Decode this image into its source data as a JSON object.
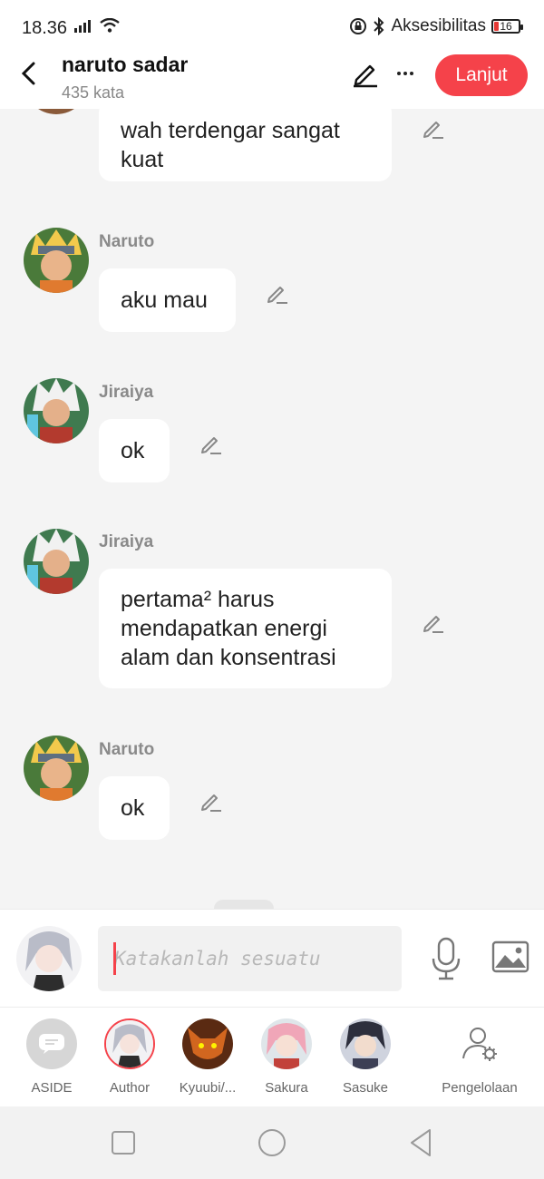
{
  "status_bar": {
    "time": "18.36",
    "accessibility_label": "Aksesibilitas",
    "battery": "16"
  },
  "header": {
    "title": "naruto sadar",
    "subtitle": "435 kata",
    "next_button": "Lanjut"
  },
  "messages": [
    {
      "speaker": "",
      "text_lines": [
        "wah terdengar sangat",
        "kuat"
      ]
    },
    {
      "speaker": "Naruto",
      "text_lines": [
        "aku mau"
      ]
    },
    {
      "speaker": "Jiraiya",
      "text_lines": [
        "ok"
      ]
    },
    {
      "speaker": "Jiraiya",
      "text_lines": [
        "pertama² harus",
        "mendapatkan energi",
        "alam dan konsentrasi"
      ]
    },
    {
      "speaker": "Naruto",
      "text_lines": [
        "ok"
      ]
    }
  ],
  "input": {
    "placeholder": "Katakanlah sesuatu",
    "value": ""
  },
  "characters": [
    {
      "label": "ASIDE",
      "selected": false
    },
    {
      "label": "Author",
      "selected": true
    },
    {
      "label": "Kyuubi/...",
      "selected": false
    },
    {
      "label": "Sakura",
      "selected": false
    },
    {
      "label": "Sasuke",
      "selected": false
    }
  ],
  "manage_label": "Pengelolaan",
  "colors": {
    "accent": "#f5424a",
    "background": "#f4f4f4",
    "bubble": "#ffffff",
    "name_text": "#8a8a8a"
  }
}
